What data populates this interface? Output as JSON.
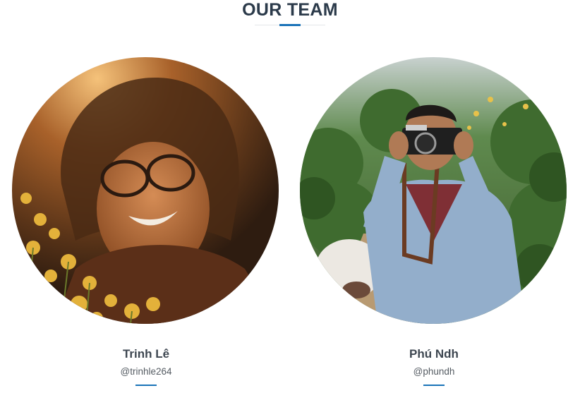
{
  "section": {
    "title": "OUR TEAM",
    "accent_color": "#1a73b8"
  },
  "members": [
    {
      "name": "Trinh Lê",
      "handle": "@trinhle264",
      "photo": "portrait-woman-with-flowers"
    },
    {
      "name": "Phú Ndh",
      "handle": "@phundh",
      "photo": "portrait-man-with-camera"
    }
  ]
}
